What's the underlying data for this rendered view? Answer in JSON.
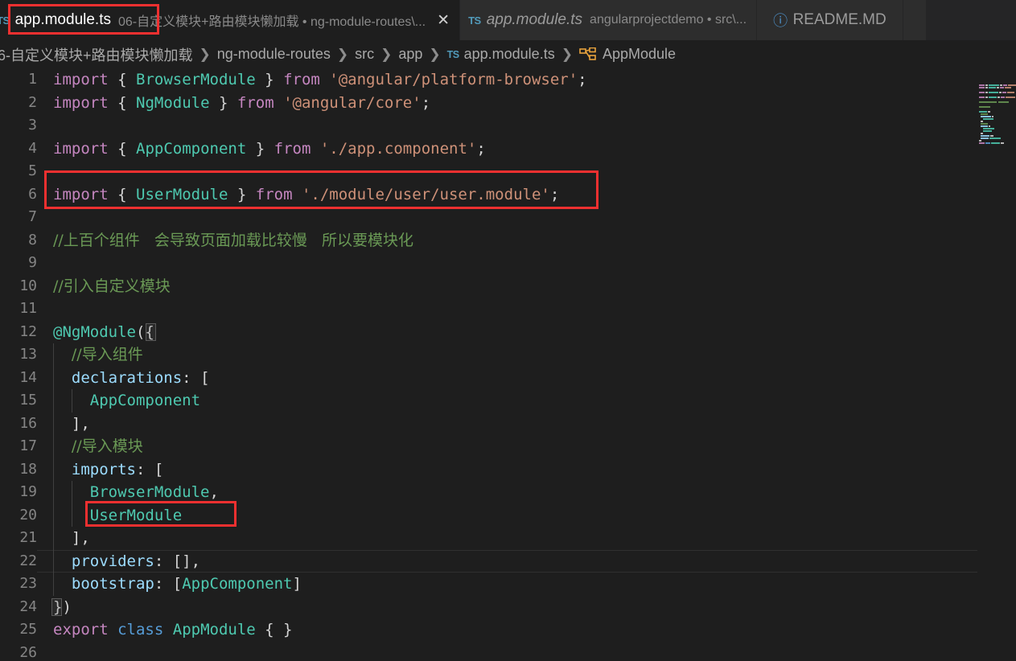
{
  "window": {
    "app": "Visual Studio Code",
    "theme": "Dark+"
  },
  "tabs": [
    {
      "icon": "typescript-file-icon",
      "icon_text": "TS",
      "label": "app.module.ts",
      "description": "06-自定义模块+路由模块懒加载 • ng-module-routes\\...",
      "active": true,
      "close_glyph": "✕"
    },
    {
      "icon": "typescript-file-icon",
      "icon_text": "TS",
      "label": "app.module.ts",
      "description": "angularprojectdemo • src\\...",
      "active": false,
      "italic": true
    },
    {
      "icon": "info-icon",
      "icon_text": "ⓘ",
      "label": "README.MD",
      "description": "",
      "active": false
    },
    {
      "icon": "file-icon",
      "icon_text": "",
      "label": "",
      "description": "",
      "active": false
    }
  ],
  "breadcrumb": {
    "separator": "❯",
    "items": [
      {
        "text": "6-自定义模块+路由模块懒加载",
        "icon": ""
      },
      {
        "text": "ng-module-routes",
        "icon": ""
      },
      {
        "text": "src",
        "icon": ""
      },
      {
        "text": "app",
        "icon": ""
      },
      {
        "text": "app.module.ts",
        "icon": "typescript-file-icon",
        "icon_text": "TS"
      },
      {
        "text": "AppModule",
        "icon": "module-symbol-icon"
      }
    ]
  },
  "editor": {
    "language": "TypeScript",
    "total_lines": 26,
    "current_line": 22,
    "line_numbers": [
      1,
      2,
      3,
      4,
      5,
      6,
      7,
      8,
      9,
      10,
      11,
      12,
      13,
      14,
      15,
      16,
      17,
      18,
      19,
      20,
      21,
      22,
      23,
      24,
      25,
      26
    ],
    "lines": [
      {
        "n": 1,
        "tokens": [
          {
            "t": "import",
            "c": "k"
          },
          {
            "t": " ",
            "c": "pn"
          },
          {
            "t": "{",
            "c": "pn"
          },
          {
            "t": " ",
            "c": "pn"
          },
          {
            "t": "BrowserModule",
            "c": "ty"
          },
          {
            "t": " ",
            "c": "pn"
          },
          {
            "t": "}",
            "c": "pn"
          },
          {
            "t": " ",
            "c": "pn"
          },
          {
            "t": "from",
            "c": "k"
          },
          {
            "t": " ",
            "c": "pn"
          },
          {
            "t": "'@angular/platform-browser'",
            "c": "st"
          },
          {
            "t": ";",
            "c": "pn"
          }
        ]
      },
      {
        "n": 2,
        "tokens": [
          {
            "t": "import",
            "c": "k"
          },
          {
            "t": " ",
            "c": "pn"
          },
          {
            "t": "{",
            "c": "pn"
          },
          {
            "t": " ",
            "c": "pn"
          },
          {
            "t": "NgModule",
            "c": "ty"
          },
          {
            "t": " ",
            "c": "pn"
          },
          {
            "t": "}",
            "c": "pn"
          },
          {
            "t": " ",
            "c": "pn"
          },
          {
            "t": "from",
            "c": "k"
          },
          {
            "t": " ",
            "c": "pn"
          },
          {
            "t": "'@angular/core'",
            "c": "st"
          },
          {
            "t": ";",
            "c": "pn"
          }
        ]
      },
      {
        "n": 3,
        "tokens": []
      },
      {
        "n": 4,
        "tokens": [
          {
            "t": "import",
            "c": "k"
          },
          {
            "t": " ",
            "c": "pn"
          },
          {
            "t": "{",
            "c": "pn"
          },
          {
            "t": " ",
            "c": "pn"
          },
          {
            "t": "AppComponent",
            "c": "ty"
          },
          {
            "t": " ",
            "c": "pn"
          },
          {
            "t": "}",
            "c": "pn"
          },
          {
            "t": " ",
            "c": "pn"
          },
          {
            "t": "from",
            "c": "k"
          },
          {
            "t": " ",
            "c": "pn"
          },
          {
            "t": "'./app.component'",
            "c": "st"
          },
          {
            "t": ";",
            "c": "pn"
          }
        ]
      },
      {
        "n": 5,
        "tokens": []
      },
      {
        "n": 6,
        "tokens": [
          {
            "t": "import",
            "c": "k"
          },
          {
            "t": " ",
            "c": "pn"
          },
          {
            "t": "{",
            "c": "pn"
          },
          {
            "t": " ",
            "c": "pn"
          },
          {
            "t": "UserModule",
            "c": "ty"
          },
          {
            "t": " ",
            "c": "pn"
          },
          {
            "t": "}",
            "c": "pn"
          },
          {
            "t": " ",
            "c": "pn"
          },
          {
            "t": "from",
            "c": "k"
          },
          {
            "t": " ",
            "c": "pn"
          },
          {
            "t": "'./module/user/user.module'",
            "c": "st"
          },
          {
            "t": ";",
            "c": "pn"
          }
        ]
      },
      {
        "n": 7,
        "tokens": []
      },
      {
        "n": 8,
        "tokens": [
          {
            "t": "//上百个组件   会导致页面加载比较慢   所以要模块化",
            "c": "cm"
          }
        ]
      },
      {
        "n": 9,
        "tokens": []
      },
      {
        "n": 10,
        "tokens": [
          {
            "t": "//引入自定义模块",
            "c": "cm"
          }
        ]
      },
      {
        "n": 11,
        "tokens": []
      },
      {
        "n": 12,
        "tokens": [
          {
            "t": "@NgModule",
            "c": "dec"
          },
          {
            "t": "(",
            "c": "pn"
          },
          {
            "t": "{",
            "c": "pn"
          }
        ]
      },
      {
        "n": 13,
        "tokens": [
          {
            "t": "  ",
            "c": "pn"
          },
          {
            "t": "//导入组件",
            "c": "cm"
          }
        ]
      },
      {
        "n": 14,
        "tokens": [
          {
            "t": "  ",
            "c": "pn"
          },
          {
            "t": "declarations",
            "c": "id"
          },
          {
            "t": ": ",
            "c": "pn"
          },
          {
            "t": "[",
            "c": "pn"
          }
        ]
      },
      {
        "n": 15,
        "tokens": [
          {
            "t": "    ",
            "c": "pn"
          },
          {
            "t": "AppComponent",
            "c": "cls"
          }
        ]
      },
      {
        "n": 16,
        "tokens": [
          {
            "t": "  ",
            "c": "pn"
          },
          {
            "t": "],",
            "c": "pn"
          }
        ]
      },
      {
        "n": 17,
        "tokens": [
          {
            "t": "  ",
            "c": "pn"
          },
          {
            "t": "//导入模块",
            "c": "cm"
          }
        ]
      },
      {
        "n": 18,
        "tokens": [
          {
            "t": "  ",
            "c": "pn"
          },
          {
            "t": "imports",
            "c": "id"
          },
          {
            "t": ": ",
            "c": "pn"
          },
          {
            "t": "[",
            "c": "pn"
          }
        ]
      },
      {
        "n": 19,
        "tokens": [
          {
            "t": "    ",
            "c": "pn"
          },
          {
            "t": "BrowserModule",
            "c": "cls"
          },
          {
            "t": ",",
            "c": "pn"
          }
        ]
      },
      {
        "n": 20,
        "tokens": [
          {
            "t": "    ",
            "c": "pn"
          },
          {
            "t": "UserModule",
            "c": "cls"
          }
        ]
      },
      {
        "n": 21,
        "tokens": [
          {
            "t": "  ",
            "c": "pn"
          },
          {
            "t": "],",
            "c": "pn"
          }
        ]
      },
      {
        "n": 22,
        "tokens": [
          {
            "t": "  ",
            "c": "pn"
          },
          {
            "t": "providers",
            "c": "id"
          },
          {
            "t": ": ",
            "c": "pn"
          },
          {
            "t": "[],",
            "c": "pn"
          }
        ]
      },
      {
        "n": 23,
        "tokens": [
          {
            "t": "  ",
            "c": "pn"
          },
          {
            "t": "bootstrap",
            "c": "id"
          },
          {
            "t": ": ",
            "c": "pn"
          },
          {
            "t": "[",
            "c": "pn"
          },
          {
            "t": "AppComponent",
            "c": "cls"
          },
          {
            "t": "]",
            "c": "pn"
          }
        ]
      },
      {
        "n": 24,
        "tokens": [
          {
            "t": "}",
            "c": "pn"
          },
          {
            "t": ")",
            "c": "pn"
          }
        ]
      },
      {
        "n": 25,
        "tokens": [
          {
            "t": "export",
            "c": "k"
          },
          {
            "t": " ",
            "c": "pn"
          },
          {
            "t": "class",
            "c": "kb"
          },
          {
            "t": " ",
            "c": "pn"
          },
          {
            "t": "AppModule",
            "c": "cls"
          },
          {
            "t": " ",
            "c": "pn"
          },
          {
            "t": "{ }",
            "c": "pn"
          }
        ]
      },
      {
        "n": 26,
        "tokens": []
      }
    ]
  },
  "annotations": [
    {
      "name": "tab-filename-highlight",
      "target": "app.module.ts tab label",
      "color": "#f03030"
    },
    {
      "name": "import-usermodule-highlight",
      "target": "line 6 import { UserModule }",
      "color": "#f03030"
    },
    {
      "name": "imports-usermodule-highlight",
      "target": "line 20 UserModule",
      "color": "#f03030"
    }
  ],
  "colors": {
    "editor_bg": "#1e1e1e",
    "tabbar_bg": "#252526",
    "inactive_tab_bg": "#2d2d2d",
    "line_number": "#858585",
    "keyword": "#c586c0",
    "class_keyword": "#569cd6",
    "type": "#4ec9b0",
    "property": "#9cdcfe",
    "string": "#ce9178",
    "comment": "#6a9955",
    "punctuation": "#d4d4d4",
    "annotation_red": "#f03030"
  },
  "minimap": {
    "rows": [
      {
        "y": 2,
        "segs": [
          {
            "x": 2,
            "w": 7,
            "c": "#c586c0"
          },
          {
            "x": 10,
            "w": 3,
            "c": "#d4d4d4"
          },
          {
            "x": 14,
            "w": 13,
            "c": "#4ec9b0"
          },
          {
            "x": 28,
            "w": 3,
            "c": "#d4d4d4"
          },
          {
            "x": 32,
            "w": 5,
            "c": "#c586c0"
          },
          {
            "x": 38,
            "w": 10,
            "c": "#ce9178"
          }
        ]
      },
      {
        "y": 5,
        "segs": [
          {
            "x": 2,
            "w": 7,
            "c": "#c586c0"
          },
          {
            "x": 10,
            "w": 3,
            "c": "#d4d4d4"
          },
          {
            "x": 14,
            "w": 9,
            "c": "#4ec9b0"
          },
          {
            "x": 24,
            "w": 3,
            "c": "#d4d4d4"
          },
          {
            "x": 28,
            "w": 5,
            "c": "#c586c0"
          },
          {
            "x": 34,
            "w": 8,
            "c": "#ce9178"
          }
        ]
      },
      {
        "y": 11,
        "segs": [
          {
            "x": 2,
            "w": 7,
            "c": "#c586c0"
          },
          {
            "x": 10,
            "w": 3,
            "c": "#d4d4d4"
          },
          {
            "x": 14,
            "w": 12,
            "c": "#4ec9b0"
          },
          {
            "x": 27,
            "w": 3,
            "c": "#d4d4d4"
          },
          {
            "x": 31,
            "w": 5,
            "c": "#c586c0"
          },
          {
            "x": 37,
            "w": 9,
            "c": "#ce9178"
          }
        ]
      },
      {
        "y": 17,
        "segs": [
          {
            "x": 2,
            "w": 7,
            "c": "#c586c0"
          },
          {
            "x": 10,
            "w": 3,
            "c": "#d4d4d4"
          },
          {
            "x": 14,
            "w": 10,
            "c": "#4ec9b0"
          },
          {
            "x": 25,
            "w": 3,
            "c": "#d4d4d4"
          },
          {
            "x": 29,
            "w": 5,
            "c": "#c586c0"
          },
          {
            "x": 35,
            "w": 12,
            "c": "#ce9178"
          }
        ]
      },
      {
        "y": 23,
        "segs": [
          {
            "x": 2,
            "w": 22,
            "c": "#6a9955"
          },
          {
            "x": 26,
            "w": 13,
            "c": "#6a9955"
          }
        ]
      },
      {
        "y": 29,
        "segs": [
          {
            "x": 2,
            "w": 14,
            "c": "#6a9955"
          }
        ]
      },
      {
        "y": 35,
        "segs": [
          {
            "x": 2,
            "w": 10,
            "c": "#4ec9b0"
          },
          {
            "x": 13,
            "w": 3,
            "c": "#d4d4d4"
          }
        ]
      },
      {
        "y": 38,
        "segs": [
          {
            "x": 4,
            "w": 9,
            "c": "#6a9955"
          }
        ]
      },
      {
        "y": 41,
        "segs": [
          {
            "x": 4,
            "w": 13,
            "c": "#9cdcfe"
          },
          {
            "x": 18,
            "w": 2,
            "c": "#d4d4d4"
          }
        ]
      },
      {
        "y": 44,
        "segs": [
          {
            "x": 7,
            "w": 13,
            "c": "#4ec9b0"
          }
        ]
      },
      {
        "y": 47,
        "segs": [
          {
            "x": 4,
            "w": 3,
            "c": "#d4d4d4"
          }
        ]
      },
      {
        "y": 50,
        "segs": [
          {
            "x": 4,
            "w": 9,
            "c": "#6a9955"
          }
        ]
      },
      {
        "y": 53,
        "segs": [
          {
            "x": 4,
            "w": 9,
            "c": "#9cdcfe"
          },
          {
            "x": 14,
            "w": 2,
            "c": "#d4d4d4"
          }
        ]
      },
      {
        "y": 56,
        "segs": [
          {
            "x": 7,
            "w": 14,
            "c": "#4ec9b0"
          }
        ]
      },
      {
        "y": 59,
        "segs": [
          {
            "x": 7,
            "w": 11,
            "c": "#4ec9b0"
          }
        ]
      },
      {
        "y": 62,
        "segs": [
          {
            "x": 4,
            "w": 3,
            "c": "#d4d4d4"
          }
        ]
      },
      {
        "y": 65,
        "segs": [
          {
            "x": 4,
            "w": 11,
            "c": "#9cdcfe"
          },
          {
            "x": 16,
            "w": 4,
            "c": "#d4d4d4"
          }
        ]
      },
      {
        "y": 68,
        "segs": [
          {
            "x": 4,
            "w": 10,
            "c": "#9cdcfe"
          },
          {
            "x": 15,
            "w": 14,
            "c": "#4ec9b0"
          }
        ]
      },
      {
        "y": 71,
        "segs": [
          {
            "x": 2,
            "w": 3,
            "c": "#d4d4d4"
          }
        ]
      },
      {
        "y": 74,
        "segs": [
          {
            "x": 2,
            "w": 7,
            "c": "#c586c0"
          },
          {
            "x": 10,
            "w": 6,
            "c": "#569cd6"
          },
          {
            "x": 17,
            "w": 11,
            "c": "#4ec9b0"
          },
          {
            "x": 29,
            "w": 4,
            "c": "#d4d4d4"
          }
        ]
      }
    ]
  }
}
